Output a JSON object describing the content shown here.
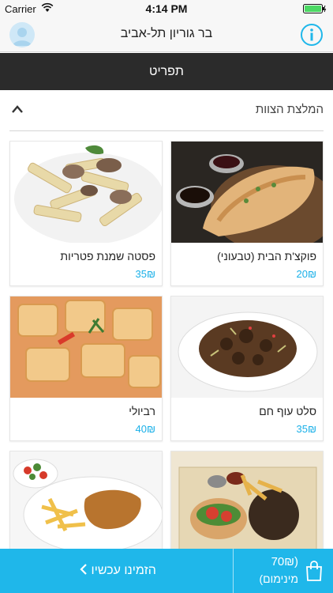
{
  "status_bar": {
    "carrier": "Carrier",
    "time": "4:14 PM"
  },
  "nav": {
    "title": "בר גוריון תל-אביב",
    "avatar_icon": "user-avatar-icon",
    "info_icon": "info-icon"
  },
  "tab": {
    "label": "תפריט"
  },
  "section": {
    "title": "המלצת הצוות",
    "toggle_icon": "chevron-up-icon"
  },
  "items": [
    {
      "name": "פוקצ'ת הבית (טבעוני)",
      "price": "20₪"
    },
    {
      "name": "פסטה שמנת פטריות",
      "price": "35₪"
    },
    {
      "name": "סלט עוף חם",
      "price": "35₪"
    },
    {
      "name": "רביולי",
      "price": "40₪"
    },
    {
      "name": "",
      "price": ""
    },
    {
      "name": "",
      "price": ""
    }
  ],
  "bottom": {
    "order_label": "הזמינו עכשיו",
    "cart_amount": "(70₪",
    "cart_min": "מינימום)",
    "cart_icon": "shopping-bag-icon"
  },
  "colors": {
    "accent": "#1fb7ea",
    "price": "#1ab0e8",
    "tab_bg": "#2b2b2b"
  }
}
